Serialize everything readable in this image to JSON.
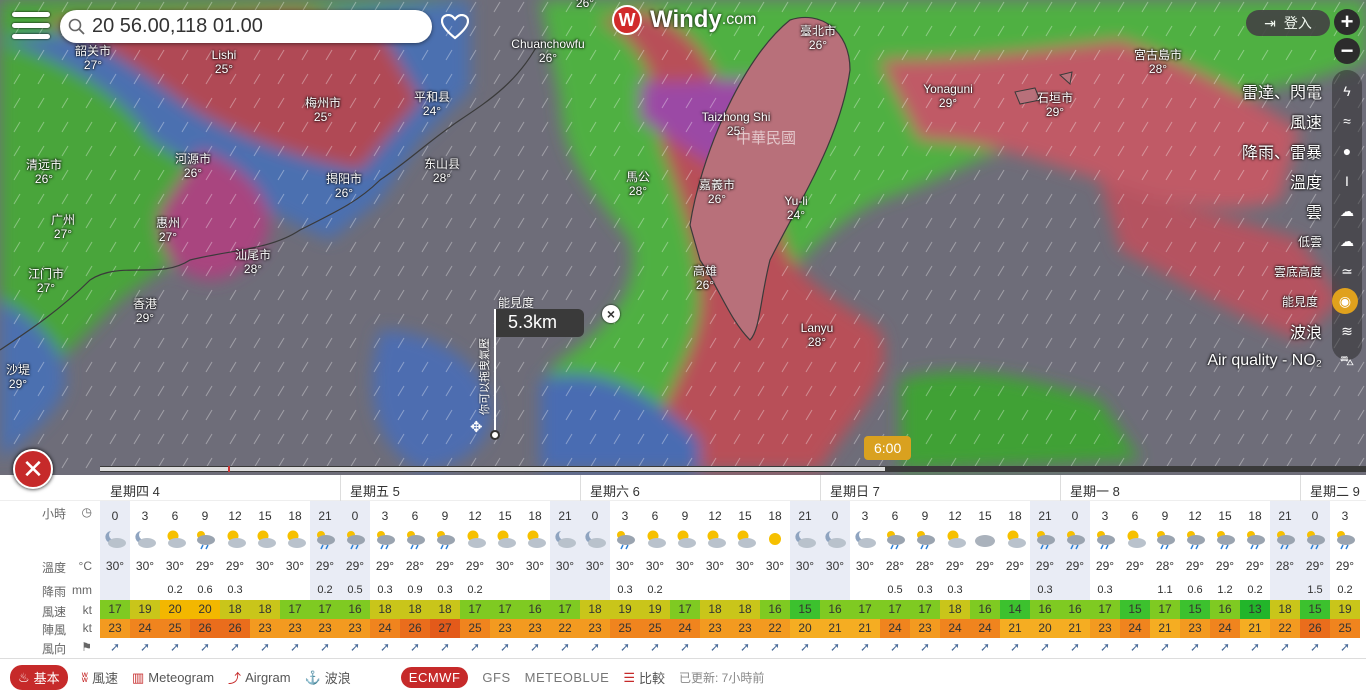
{
  "search": {
    "value": "20 56.00,118 01.00",
    "placeholder": ""
  },
  "logo": {
    "brand": "Windy",
    "suffix": ".com",
    "mark": "W"
  },
  "login_label": "登入",
  "zoom": {
    "in": "+",
    "out": "−"
  },
  "cities": [
    {
      "name": "韶关市",
      "temp": "27°"
    },
    {
      "name": "Lishi",
      "temp": "25°"
    },
    {
      "name": "Chuanchowfu",
      "temp": "26°"
    },
    {
      "name": "梅州市",
      "temp": "25°"
    },
    {
      "name": "平和县",
      "temp": "24°"
    },
    {
      "name": "清远市",
      "temp": "26°"
    },
    {
      "name": "河源市",
      "temp": "26°"
    },
    {
      "name": "揭阳市",
      "temp": "26°"
    },
    {
      "name": "东山县",
      "temp": "28°"
    },
    {
      "name": "广州",
      "temp": "27°"
    },
    {
      "name": "惠州",
      "temp": "27°"
    },
    {
      "name": "汕尾市",
      "temp": "28°"
    },
    {
      "name": "江门市",
      "temp": "27°"
    },
    {
      "name": "香港",
      "temp": "29°"
    },
    {
      "name": "沙堤",
      "temp": "29°"
    },
    {
      "name": "臺北市",
      "temp": "26°"
    },
    {
      "name": "Taizhong Shi",
      "temp": "25°"
    },
    {
      "name": "馬公",
      "temp": "28°"
    },
    {
      "name": "嘉義市",
      "temp": "26°"
    },
    {
      "name": "Yu-li",
      "temp": "24°"
    },
    {
      "name": "高雄",
      "temp": "26°"
    },
    {
      "name": "Lanyu",
      "temp": "28°"
    },
    {
      "name": "Yonaguni",
      "temp": "29°"
    },
    {
      "name": "石垣市",
      "temp": "29°"
    },
    {
      "name": "宮古島市",
      "temp": "28°"
    },
    {
      "name": "",
      "temp": "26°"
    }
  ],
  "country_label": "中華民國",
  "layers": [
    {
      "label": "雷達、閃電",
      "icon": "radar-icon"
    },
    {
      "label": "風速",
      "icon": "wind-icon"
    },
    {
      "label": "降雨、雷暴",
      "icon": "rain-drop-icon"
    },
    {
      "label": "溫度",
      "icon": "thermometer-icon"
    },
    {
      "label": "雲",
      "icon": "cloud-icon"
    },
    {
      "label": "低雲",
      "icon": "low-cloud-icon"
    },
    {
      "label": "雲底高度",
      "icon": "cloud-base-icon"
    },
    {
      "label": "能見度",
      "icon": "eye-icon"
    },
    {
      "label": "波浪",
      "icon": "waves-icon"
    },
    {
      "label": "Air quality - NO₂",
      "icon": "car-icon"
    }
  ],
  "active_layer": "能見度",
  "popup": {
    "label": "能見度",
    "value": "5.3km",
    "drag_hint": "你可以拖曳氣壓"
  },
  "time_bubble": "6:00",
  "timeline_progress": 0.62,
  "forecast": {
    "days": [
      "星期四 4",
      "星期五 5",
      "星期六 6",
      "星期日 7",
      "星期一 8",
      "星期二 9"
    ],
    "row_labels": {
      "hours": "小時",
      "temp": "溫度",
      "temp_unit": "°C",
      "rain": "降雨",
      "rain_unit": "mm",
      "wind": "風速",
      "wind_unit": "kt",
      "gust": "陣風",
      "gust_unit": "kt",
      "dir": "風向"
    },
    "hours": [
      "0",
      "3",
      "6",
      "9",
      "12",
      "15",
      "18",
      "21",
      "0",
      "3",
      "6",
      "9",
      "12",
      "15",
      "18",
      "21",
      "0",
      "3",
      "6",
      "9",
      "12",
      "15",
      "18",
      "21",
      "0",
      "3",
      "6",
      "9",
      "12",
      "15",
      "18",
      "21",
      "0",
      "3",
      "6",
      "9",
      "12",
      "15",
      "18",
      "21",
      "0",
      "3"
    ],
    "temps": [
      "30°",
      "30°",
      "30°",
      "29°",
      "29°",
      "30°",
      "30°",
      "29°",
      "29°",
      "29°",
      "28°",
      "29°",
      "29°",
      "30°",
      "30°",
      "30°",
      "30°",
      "30°",
      "30°",
      "30°",
      "30°",
      "30°",
      "30°",
      "30°",
      "30°",
      "30°",
      "28°",
      "28°",
      "29°",
      "29°",
      "29°",
      "29°",
      "29°",
      "29°",
      "29°",
      "28°",
      "29°",
      "29°",
      "29°",
      "28°",
      "29°",
      "29°"
    ],
    "rain": [
      "",
      "",
      "0.2",
      "0.6",
      "0.3",
      "",
      "",
      "0.2",
      "0.5",
      "0.3",
      "0.9",
      "0.3",
      "0.2",
      "",
      "",
      "",
      "",
      "0.3",
      "0.2",
      "",
      "",
      "",
      "",
      "",
      "",
      "",
      "0.5",
      "0.3",
      "0.3",
      "",
      "",
      "0.3",
      "",
      "0.3",
      "",
      "1.1",
      "0.6",
      "1.2",
      "0.2",
      "",
      "1.5",
      "0.2"
    ],
    "wind": [
      17,
      19,
      20,
      20,
      18,
      18,
      17,
      17,
      16,
      18,
      18,
      18,
      17,
      17,
      16,
      17,
      18,
      19,
      19,
      17,
      18,
      18,
      16,
      15,
      16,
      17,
      17,
      17,
      18,
      16,
      14,
      16,
      16,
      17,
      15,
      17,
      15,
      16,
      13,
      18,
      15,
      19
    ],
    "gust": [
      23,
      24,
      25,
      26,
      26,
      23,
      23,
      23,
      23,
      24,
      26,
      27,
      25,
      23,
      23,
      22,
      23,
      25,
      25,
      24,
      23,
      23,
      22,
      20,
      21,
      21,
      24,
      23,
      24,
      24,
      21,
      20,
      21,
      23,
      24,
      21,
      23,
      24,
      21,
      22,
      26,
      25
    ],
    "weather_icons": [
      "partly-cloudy-night-icon",
      "partly-cloudy-night-icon",
      "sun-cloud-icon",
      "rain-cloud-icon",
      "sun-cloud-icon",
      "sun-cloud-icon",
      "sun-cloud-icon",
      "rain-cloud-icon",
      "rain-cloud-icon",
      "rain-cloud-icon",
      "rain-cloud-icon",
      "rain-cloud-icon",
      "sun-cloud-icon",
      "sun-cloud-icon",
      "sun-cloud-icon",
      "partly-cloudy-night-icon",
      "partly-cloudy-night-icon",
      "rain-cloud-icon",
      "sun-cloud-icon",
      "sun-cloud-icon",
      "sun-cloud-icon",
      "sun-cloud-icon",
      "sun-icon",
      "partly-cloudy-night-icon",
      "partly-cloudy-night-icon",
      "partly-cloudy-night-icon",
      "rain-cloud-icon",
      "rain-cloud-icon",
      "sun-cloud-icon",
      "cloud-icon",
      "sun-cloud-icon",
      "rain-cloud-icon",
      "rain-cloud-icon",
      "rain-cloud-icon",
      "sun-cloud-icon",
      "rain-cloud-icon",
      "rain-cloud-icon",
      "rain-cloud-icon",
      "rain-cloud-icon",
      "rain-cloud-icon",
      "rain-cloud-icon",
      "rain-cloud-icon"
    ]
  },
  "bottom": {
    "tabs": [
      "基本",
      "風速",
      "Meteogram",
      "Airgram",
      "波浪"
    ],
    "models": [
      "ECMWF",
      "GFS",
      "METEOBLUE"
    ],
    "compare": "比較",
    "updated": "已更新: 7小時前"
  },
  "colors": {
    "accent": "#c62a2a",
    "bubble": "#d9a11f",
    "wind_high": "#f5c400",
    "wind_low": "#3fbf2e",
    "gust": "#f08a1f"
  }
}
